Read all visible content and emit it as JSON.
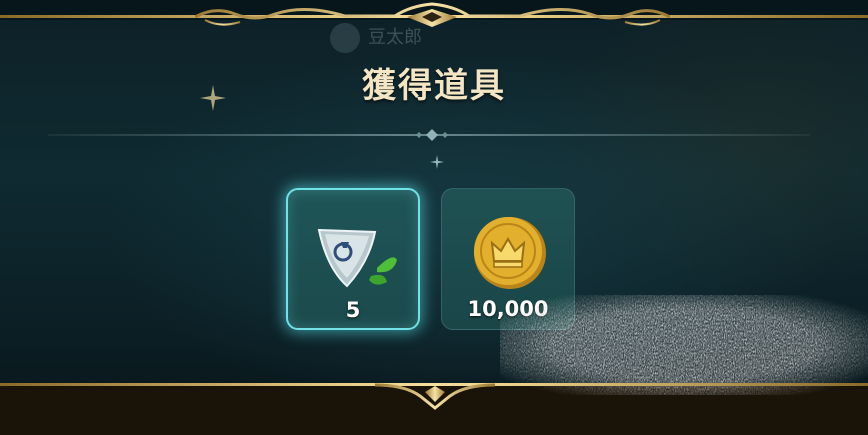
{
  "header": {
    "title": "獲得道具",
    "faded_player_name": "豆太郎"
  },
  "rewards": [
    {
      "icon": "white-crystal-shard-with-leaves-icon",
      "count": "5"
    },
    {
      "icon": "gold-crown-coin-icon",
      "count": "10,000"
    }
  ],
  "colors": {
    "frame_gold": "#e9cf86",
    "title_text": "#f4e6c4",
    "card_glow": "#6fe3e7",
    "card_bg": "#1f5557",
    "coin_gold": "#d9a521"
  }
}
